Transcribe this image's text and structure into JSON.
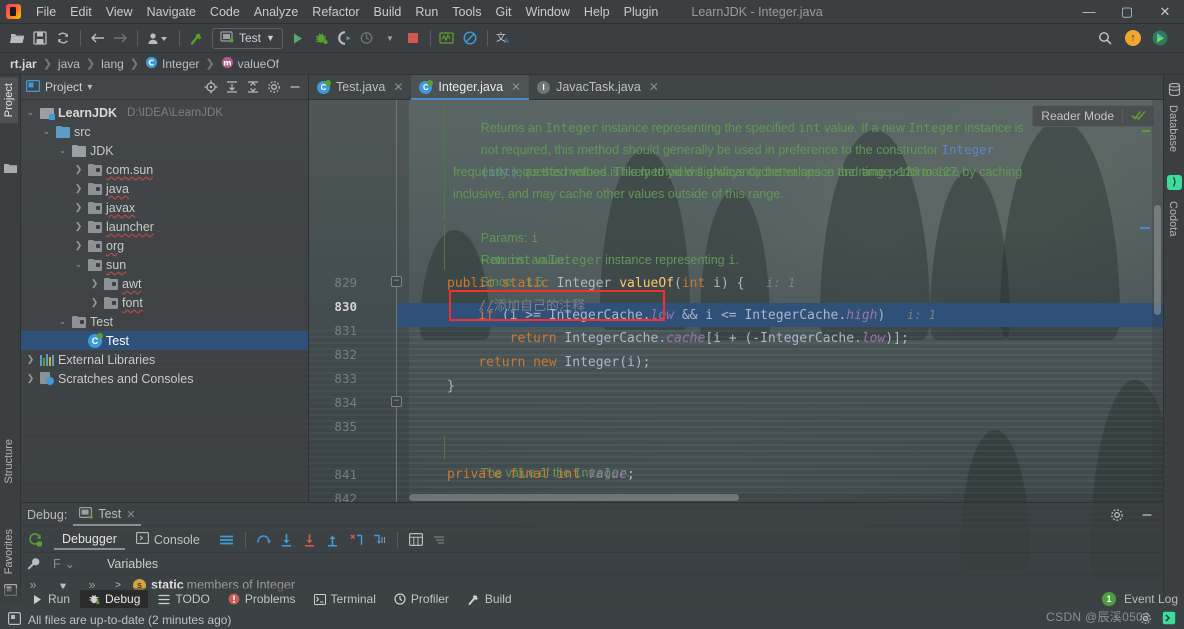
{
  "window": {
    "title": "LearnJDK - Integer.java",
    "minimize": "—",
    "maximize": "▢",
    "close": "✕"
  },
  "menubar": {
    "items": [
      "File",
      "Edit",
      "View",
      "Navigate",
      "Code",
      "Analyze",
      "Refactor",
      "Build",
      "Run",
      "Tools",
      "Git",
      "Window",
      "Help",
      "Plugin"
    ]
  },
  "toolbar": {
    "run_config": "Test",
    "open_icon": "open-folder-icon",
    "save_icon": "save-icon",
    "sync_icon": "sync-icon",
    "back_icon": "back-arrow-icon",
    "forward_icon": "forward-arrow-icon",
    "vcs_icon": "vcs-user-icon",
    "build_icon": "build-hammer-icon",
    "run_icon": "run-icon",
    "debug_icon": "debug-icon",
    "coverage_icon": "coverage-icon",
    "profile_icon": "profile-icon",
    "stop_icon": "stop-icon",
    "monitor_icon": "monitor-icon",
    "block_icon": "block-icon",
    "translate_icon": "translate-icon",
    "search_icon": "search-icon",
    "update_badge": "↑",
    "ide_icon": "ide-icon"
  },
  "breadcrumb": {
    "items": [
      {
        "label": "rt.jar",
        "icon": "",
        "bold": true
      },
      {
        "label": "java",
        "icon": ""
      },
      {
        "label": "lang",
        "icon": ""
      },
      {
        "label": "Integer",
        "icon": "class-icon"
      },
      {
        "label": "valueOf",
        "icon": "method-icon"
      }
    ],
    "separator": "❯"
  },
  "left_strip": {
    "top": "Project",
    "bottom": [
      "Structure",
      "Favorites"
    ]
  },
  "right_strip": {
    "items": [
      "Database",
      "Codota"
    ]
  },
  "project_panel": {
    "title": "Project",
    "dropdown": "▾",
    "icons": [
      "locate-icon",
      "expand-all-icon",
      "collapse-all-icon",
      "settings-gear-icon",
      "hide-icon"
    ],
    "tree": [
      {
        "label": "LearnJDK",
        "hint": "D:\\IDEA\\LearnJDK",
        "indent": 0,
        "arrow": "v",
        "icon": "module",
        "bold": true
      },
      {
        "label": "src",
        "hint": "",
        "indent": 1,
        "arrow": "v",
        "icon": "folder-src"
      },
      {
        "label": "JDK",
        "hint": "",
        "indent": 2,
        "arrow": "v",
        "icon": "folder"
      },
      {
        "label": "com.sun",
        "hint": "",
        "indent": 3,
        "arrow": ">",
        "icon": "package",
        "squiggle": true
      },
      {
        "label": "java",
        "hint": "",
        "indent": 3,
        "arrow": ">",
        "icon": "package",
        "squiggle": true
      },
      {
        "label": "javax",
        "hint": "",
        "indent": 3,
        "arrow": ">",
        "icon": "package",
        "squiggle": true
      },
      {
        "label": "launcher",
        "hint": "",
        "indent": 3,
        "arrow": ">",
        "icon": "package",
        "squiggle": true
      },
      {
        "label": "org",
        "hint": "",
        "indent": 3,
        "arrow": ">",
        "icon": "package",
        "squiggle": true
      },
      {
        "label": "sun",
        "hint": "",
        "indent": 3,
        "arrow": "v",
        "icon": "package",
        "squiggle": true
      },
      {
        "label": "awt",
        "hint": "",
        "indent": 4,
        "arrow": ">",
        "icon": "package",
        "squiggle": true
      },
      {
        "label": "font",
        "hint": "",
        "indent": 4,
        "arrow": ">",
        "icon": "package",
        "squiggle": true
      },
      {
        "label": "Test",
        "hint": "",
        "indent": 2,
        "arrow": "v",
        "icon": "package"
      },
      {
        "label": "Test",
        "hint": "",
        "indent": 3,
        "arrow": "",
        "icon": "class",
        "selected": true
      },
      {
        "label": "External Libraries",
        "hint": "",
        "indent": 0,
        "arrow": ">",
        "icon": "library"
      },
      {
        "label": "Scratches and Consoles",
        "hint": "",
        "indent": 0,
        "arrow": ">",
        "icon": "scratch"
      }
    ]
  },
  "editor": {
    "tabs": [
      {
        "label": "Test.java",
        "icon": "java-class-icon",
        "active": false,
        "close": "✕"
      },
      {
        "label": "Integer.java",
        "icon": "java-class-icon",
        "active": true,
        "close": "✕"
      },
      {
        "label": "JavacTask.java",
        "icon": "java-interface-icon",
        "active": false,
        "close": "✕"
      }
    ],
    "reader_mode": {
      "label": "Reader Mode",
      "check_icon": "double-check-icon"
    },
    "line_numbers": [
      "829",
      "830",
      "831",
      "832",
      "833",
      "834",
      "835",
      "",
      "841",
      "842"
    ],
    "current_line": "830",
    "javadoc": {
      "paragraph_parts": [
        {
          "t": "Returns an ",
          "k": "p"
        },
        {
          "t": "Integer",
          "k": "m"
        },
        {
          "t": " instance representing the specified ",
          "k": "p"
        },
        {
          "t": "int",
          "k": "m"
        },
        {
          "t": " value. If a new ",
          "k": "p"
        },
        {
          "t": "Integer",
          "k": "m"
        },
        {
          "t": " instance is",
          "k": "p"
        }
      ],
      "line2_a": "not required, this method should generally be used in preference to the constructor ",
      "line2_link": "Integer",
      "line3_link": "(int)",
      "line3_b": ", as this method is likely to yield significantly better space and time performance by caching",
      "line4": "frequently requested values. This method will always cache values in the range -128 to 127,",
      "line5": "inclusive, and may cache other values outside of this range.",
      "params_label": "Params:",
      "params_value_a": "i",
      "params_dash": "–",
      "params_value_b": "an ",
      "params_type": "int",
      "params_value_c": " value.",
      "returns_label": "Returns:",
      "returns_a": "an ",
      "returns_type": "Integer",
      "returns_b": " instance representing ",
      "returns_i": "i",
      "returns_dot": ".",
      "since_label": "Since:",
      "since_value": "1.5",
      "field_doc": "The value of the ",
      "field_doc_type": "Integer",
      "field_doc_end": "."
    },
    "code_lines": [
      {
        "n": "829",
        "tokens": [
          {
            "t": "public",
            "c": "kw"
          },
          {
            "t": " ",
            "c": ""
          },
          {
            "t": "static",
            "c": "kw"
          },
          {
            "t": " ",
            "c": ""
          },
          {
            "t": "Integer",
            "c": "cls-n"
          },
          {
            "t": " ",
            "c": ""
          },
          {
            "t": "valueOf",
            "c": "fn"
          },
          {
            "t": "(",
            "c": ""
          },
          {
            "t": "int",
            "c": "kw"
          },
          {
            "t": " i) {",
            "c": ""
          },
          {
            "t": "   i: 1",
            "c": "hint"
          }
        ]
      },
      {
        "n": "830",
        "tokens": [
          {
            "t": "    //添加自己的注释",
            "c": "comment"
          }
        ]
      },
      {
        "n": "831",
        "tokens": [
          {
            "t": "    ",
            "c": ""
          },
          {
            "t": "if",
            "c": "kw"
          },
          {
            "t": " (i >= IntegerCache.",
            "c": ""
          },
          {
            "t": "low",
            "c": "fld"
          },
          {
            "t": " && i <= IntegerCache.",
            "c": ""
          },
          {
            "t": "high",
            "c": "fld"
          },
          {
            "t": ")",
            "c": ""
          },
          {
            "t": "   i: 1",
            "c": "hint"
          }
        ]
      },
      {
        "n": "832",
        "tokens": [
          {
            "t": "        ",
            "c": ""
          },
          {
            "t": "return",
            "c": "kw"
          },
          {
            "t": " IntegerCache.",
            "c": ""
          },
          {
            "t": "cache",
            "c": "fld"
          },
          {
            "t": "[i + (-IntegerCache.",
            "c": ""
          },
          {
            "t": "low",
            "c": "fld"
          },
          {
            "t": ")];",
            "c": ""
          }
        ]
      },
      {
        "n": "833",
        "tokens": [
          {
            "t": "    ",
            "c": ""
          },
          {
            "t": "return",
            "c": "kw"
          },
          {
            "t": " ",
            "c": ""
          },
          {
            "t": "new",
            "c": "kw"
          },
          {
            "t": " Integer(i);",
            "c": ""
          }
        ]
      },
      {
        "n": "834",
        "tokens": [
          {
            "t": "}",
            "c": ""
          }
        ]
      },
      {
        "n": "842",
        "tokens": [
          {
            "t": "private",
            "c": "kw"
          },
          {
            "t": " ",
            "c": ""
          },
          {
            "t": "final",
            "c": "kw"
          },
          {
            "t": " ",
            "c": ""
          },
          {
            "t": "int",
            "c": "kw"
          },
          {
            "t": " ",
            "c": ""
          },
          {
            "t": "value",
            "c": "fld"
          },
          {
            "t": ";",
            "c": ""
          }
        ]
      }
    ],
    "highlighted_line": "831",
    "annotation_box": "red-rectangle-around-comment"
  },
  "debug_panel": {
    "title": "Debug:",
    "session": "Test",
    "session_close": "✕",
    "tabs": [
      {
        "label": "Debugger",
        "icon": "",
        "active": true
      },
      {
        "label": "Console",
        "icon": "console-icon",
        "active": false
      }
    ],
    "toolbar_icons": [
      "layout-icon",
      "step-over-icon",
      "step-into-icon",
      "force-step-into-icon",
      "step-out-icon",
      "run-to-cursor-icon",
      "drop-frame-icon",
      "evaluate-icon",
      "mute-icon"
    ],
    "frame_selector": "F",
    "frame_chevron": "⌄",
    "variables_label": "Variables",
    "variable_row": {
      "arrow": ">",
      "badge": "s",
      "name": "static",
      "desc": " members of Integer"
    },
    "settings_icon": "settings-gear-icon",
    "hide_icon": "hide-icon",
    "restore_icon": "restore-layout-icon",
    "overflow": "»"
  },
  "tool_tabs": {
    "items": [
      {
        "label": "Run",
        "icon": "run-icon",
        "active": false
      },
      {
        "label": "Debug",
        "icon": "debug-icon",
        "active": true
      },
      {
        "label": "TODO",
        "icon": "todo-icon",
        "active": false
      },
      {
        "label": "Problems",
        "icon": "problems-icon",
        "active": false
      },
      {
        "label": "Terminal",
        "icon": "terminal-icon",
        "active": false
      },
      {
        "label": "Profiler",
        "icon": "profiler-icon",
        "active": false
      },
      {
        "label": "Build",
        "icon": "build-hammer-icon",
        "active": false
      }
    ],
    "event_log": {
      "label": "Event Log",
      "count": "1"
    }
  },
  "statusbar": {
    "message": "All files are up-to-date (2 minutes ago)",
    "icon": "files-icon"
  },
  "watermark": "CSDN @辰溪0502",
  "colors": {
    "accent_blue": "#4a88c7",
    "selection_blue": "#2f5079",
    "keyword_orange": "#cc7832",
    "doc_green": "#629755",
    "field_purple": "#9876aa",
    "method_yellow": "#ffc66d",
    "annotation_red": "#f42f2f",
    "panel_gray": "#3c3f41"
  }
}
